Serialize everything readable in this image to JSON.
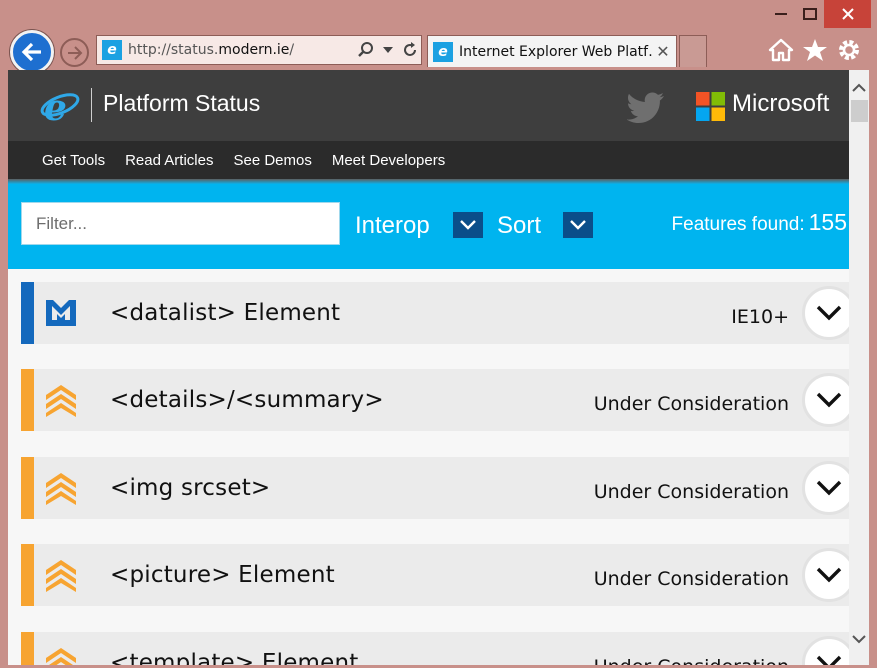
{
  "browser": {
    "address_url_prefix": "http://status.",
    "address_url_domain": "modern.ie",
    "address_url_suffix": "/",
    "tab_title": "Internet Explorer Web Platf…",
    "favicon_letter": "e"
  },
  "site": {
    "title": "Platform Status",
    "brand": "Microsoft",
    "nav": [
      "Get Tools",
      "Read Articles",
      "See Demos",
      "Meet Developers"
    ]
  },
  "filters": {
    "filter_placeholder": "Filter...",
    "interop_label": "Interop",
    "sort_label": "Sort",
    "features_label": "Features found:",
    "features_count": "155"
  },
  "features": [
    {
      "name": "<datalist> Element",
      "status": "IE10+",
      "color": "#1469bd",
      "icon": "ie-shipped-icon"
    },
    {
      "name": "<details>/<summary>",
      "status": "Under Consideration",
      "color": "#f7a431",
      "icon": "under-consideration-icon"
    },
    {
      "name": "<img srcset>",
      "status": "Under Consideration",
      "color": "#f7a431",
      "icon": "under-consideration-icon"
    },
    {
      "name": "<picture> Element",
      "status": "Under Consideration",
      "color": "#f7a431",
      "icon": "under-consideration-icon"
    },
    {
      "name": "<template> Element",
      "status": "Under Consideration",
      "color": "#f7a431",
      "icon": "under-consideration-icon"
    }
  ],
  "colors": {
    "accent": "#00b4ef",
    "header": "#3e3e3e",
    "nav": "#2b2b2b"
  }
}
